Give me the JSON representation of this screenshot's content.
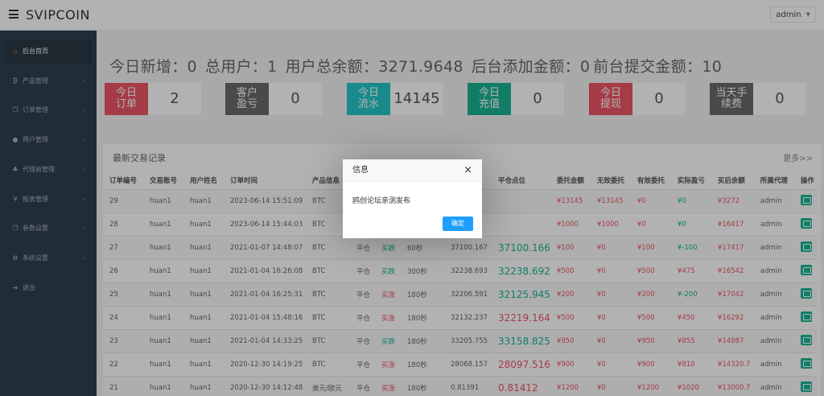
{
  "app": {
    "brand": "SVIPCOIN",
    "user": "admin"
  },
  "sidebar": {
    "items": [
      {
        "label": "后台首页",
        "icon": "home-icon",
        "glyph": "⌂"
      },
      {
        "label": "产品管理",
        "icon": "bitcoin-icon",
        "glyph": "₿"
      },
      {
        "label": "订单管理",
        "icon": "copy-icon",
        "glyph": "❐"
      },
      {
        "label": "用户管理",
        "icon": "user-icon",
        "glyph": "●"
      },
      {
        "label": "代理商管理",
        "icon": "sitemap-icon",
        "glyph": "♣"
      },
      {
        "label": "报表管理",
        "icon": "yen-icon",
        "glyph": "¥"
      },
      {
        "label": "参数设置",
        "icon": "copy-icon",
        "glyph": "❐"
      },
      {
        "label": "系统设置",
        "icon": "gears-icon",
        "glyph": "⚙"
      },
      {
        "label": "退出",
        "icon": "sign-out-icon",
        "glyph": "➜"
      }
    ]
  },
  "summary": {
    "today_new": "今日新增：0",
    "total_users": "总用户：1",
    "balance": "用户总余额：3271.9648",
    "backend_add": "后台添加金额：0",
    "frontend_submit": "前台提交金额：10"
  },
  "stats": [
    {
      "label": "今日订单",
      "value": "2",
      "color": "#ed5565"
    },
    {
      "label": "客户盈亏",
      "value": "0",
      "color": "#676a6c"
    },
    {
      "label": "今日流水",
      "value": "14145",
      "color": "#23c6c8"
    },
    {
      "label": "今日充值",
      "value": "0",
      "color": "#1ab394"
    },
    {
      "label": "今日提现",
      "value": "0",
      "color": "#ed5565"
    },
    {
      "label": "当天手续费",
      "value": "0",
      "color": "#676a6c"
    }
  ],
  "trades": {
    "title": "最新交易记录",
    "more": "更多>>",
    "headers": [
      "订单编号",
      "交易账号",
      "用户姓名",
      "订单时间",
      "产品信息",
      "",
      "",
      "",
      "",
      "平仓点位",
      "委托金额",
      "无效委托",
      "有效委托",
      "实际盈亏",
      "买后余额",
      "所属代理",
      "操作"
    ],
    "rows": [
      [
        "29",
        "huan1",
        "huan1",
        "2023-06-14 15:51:09",
        "BTC",
        "",
        "",
        "",
        "",
        "",
        "¥13145",
        "¥13145",
        "¥0",
        "¥0",
        "¥3272",
        "admin"
      ],
      [
        "28",
        "huan1",
        "huan1",
        "2023-06-14 15:44:03",
        "BTC",
        "",
        "",
        "",
        "",
        "",
        "¥1000",
        "¥1000",
        "¥0",
        "¥0",
        "¥16417",
        "admin"
      ],
      [
        "27",
        "huan1",
        "huan1",
        "2021-01-07 14:48:07",
        "BTC",
        "平仓",
        "买跌",
        "60秒",
        "37100.167",
        "37100.166",
        "¥100",
        "¥0",
        "¥100",
        "¥-100",
        "¥17417",
        "admin"
      ],
      [
        "26",
        "huan1",
        "huan1",
        "2021-01-04 16:26:08",
        "BTC",
        "平仓",
        "买跌",
        "300秒",
        "32238.693",
        "32238.692",
        "¥500",
        "¥0",
        "¥500",
        "¥475",
        "¥16542",
        "admin"
      ],
      [
        "25",
        "huan1",
        "huan1",
        "2021-01-04 16:25:31",
        "BTC",
        "平仓",
        "买涨",
        "180秒",
        "32206.591",
        "32125.945",
        "¥200",
        "¥0",
        "¥200",
        "¥-200",
        "¥17042",
        "admin"
      ],
      [
        "24",
        "huan1",
        "huan1",
        "2021-01-04 15:48:16",
        "BTC",
        "平仓",
        "买涨",
        "180秒",
        "32132.237",
        "32219.164",
        "¥500",
        "¥0",
        "¥500",
        "¥450",
        "¥16292",
        "admin"
      ],
      [
        "23",
        "huan1",
        "huan1",
        "2021-01-04 14:33:25",
        "BTC",
        "平仓",
        "买跌",
        "180秒",
        "33205.755",
        "33158.825",
        "¥950",
        "¥0",
        "¥950",
        "¥855",
        "¥14987",
        "admin"
      ],
      [
        "22",
        "huan1",
        "huan1",
        "2020-12-30 14:19:25",
        "BTC",
        "平仓",
        "买涨",
        "180秒",
        "28068.157",
        "28097.516",
        "¥900",
        "¥0",
        "¥900",
        "¥810",
        "¥14320.7",
        "admin"
      ],
      [
        "21",
        "huan1",
        "huan1",
        "2020-12-30 14:12:48",
        "美元/欧元",
        "平仓",
        "买涨",
        "180秒",
        "0.81391",
        "0.81412",
        "¥1200",
        "¥0",
        "¥1200",
        "¥1020",
        "¥13000.7",
        "admin"
      ]
    ],
    "row_colors": {
      "direction": {
        "买涨": "#ed5565",
        "买跌": "#1ab394"
      },
      "close_price": [
        "",
        "",
        "green",
        "green",
        "green",
        "red",
        "green",
        "red",
        "red"
      ],
      "profit": [
        "green",
        "green",
        "green",
        "red",
        "green",
        "red",
        "red",
        "red",
        "red"
      ]
    }
  },
  "modal": {
    "title": "信息",
    "message": "鸥创论坛亲测发布",
    "confirm": "确定",
    "close": "×"
  }
}
